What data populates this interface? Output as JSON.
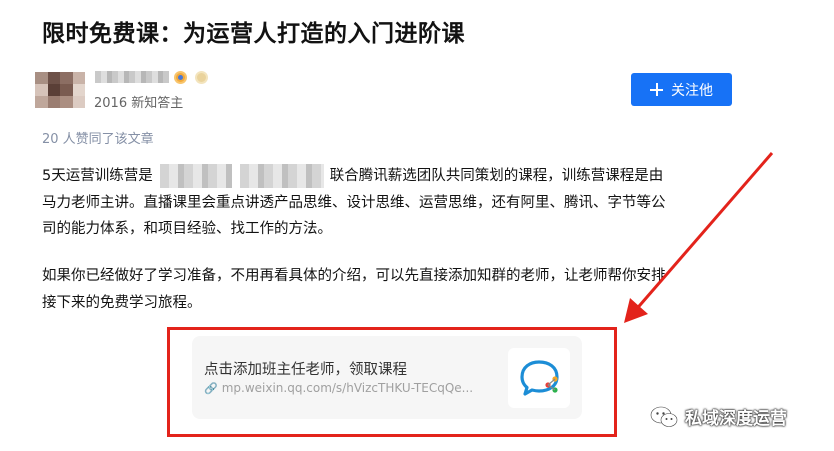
{
  "article": {
    "title": "限时免费课：为运营人打造的入门进阶课"
  },
  "author": {
    "meta": "2016 新知答主"
  },
  "follow_button": {
    "label": "关注他",
    "color": "#1772f6"
  },
  "likes_text": "20 人赞同了该文章",
  "body": {
    "p1_line1_start": "5天运营训练营是",
    "p1_line1_end": "联合腾讯薪选团队共同策划的课程，训练营课程是由",
    "p1_line2": "马力老师主讲。直播课里会重点讲透产品思维、设计思维、运营思维，还有阿里、腾讯、字节等公",
    "p1_line3": "司的能力体系，和项目经验、找工作的方法。",
    "p2_line1": "如果你已经做好了学习准备，不用再看具体的介绍，可以先直接添加知群的老师，让老师帮你安排",
    "p2_line2": "接下来的免费学习旅程。"
  },
  "link_card": {
    "title": "点击添加班主任老师，领取课程",
    "url": "mp.weixin.qq.com/s/hVizcTHKU-TECqQe...",
    "highlight_color": "#e3231b"
  },
  "watermark": {
    "text": "私域深度运营"
  },
  "icons": [
    "plus-icon",
    "link-icon",
    "chat-bubble-icon",
    "wechat-icon",
    "arrow-annotation"
  ]
}
